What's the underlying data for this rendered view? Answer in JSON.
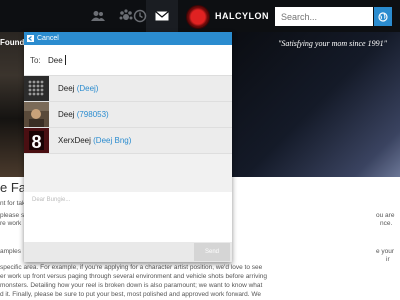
{
  "nav": {
    "icons": [
      "friends-icon",
      "clan-icon",
      "activity-icon",
      "messages-icon"
    ],
    "username": "HALCYLON",
    "search": {
      "placeholder": "Search..."
    },
    "accent": "#2b8ccf"
  },
  "page": {
    "left_fragment": "Found",
    "tagline": "\"Satisfying your mom since 1991\"",
    "article_heading": "e Fan",
    "article_lines": [
      "nt for tak",
      "please s",
      "re work",
      "amples",
      "specific area. For example, if you're applying for a character artist position, we'd love to see",
      "er work up front versus paging through several environment and vehicle shots before arriving",
      "monsters. Detailing how your reel is broken down is also paramount; we want to know what",
      "d it. Finally, please be sure to put your best, most polished and approved work forward. We"
    ],
    "right_fragments": [
      "ou are",
      "nce.",
      "e your",
      "ir"
    ]
  },
  "panel": {
    "cancel_label": "Cancel",
    "to_label": "To:",
    "to_value": "Dee",
    "suggestions": [
      {
        "name": "Deej",
        "handle": "(Deej)",
        "avatar": "grid-avatar-icon"
      },
      {
        "name": "Deej",
        "handle": "(798053)",
        "avatar": "photo-avatar-icon"
      },
      {
        "name": "XerxDeej",
        "handle": "(Deej Bng)",
        "avatar": "number-8-avatar-icon"
      }
    ],
    "compose_placeholder": "Dear Bungie...",
    "send_label": "Send"
  }
}
